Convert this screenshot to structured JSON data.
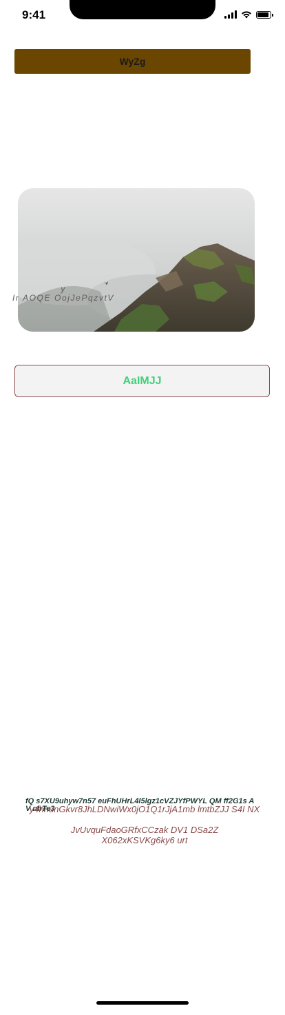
{
  "status_bar": {
    "time": "9:41"
  },
  "top_button": {
    "label": "WyZg",
    "color": "#6b4600"
  },
  "hero": {
    "caption_line1": "y",
    "caption_line2": "Ir AOQE OojJePqzvtV"
  },
  "outline_button": {
    "label": "AaIMJJ",
    "text_color": "#3fd17a",
    "border_color": "#8a4a4a"
  },
  "footer": {
    "bold_line_1": "fQ s7XU9uhyw7n57 euFhUHrL4l5lgz1cVZJYfPWYL QM ff2G1s  A",
    "bold_line_2": "V nbTe3",
    "para_line_1": "y4hnunGkvr8JhLDNwiWx0jO1Q1rJjA1mb lmtbZJJ S4I NX",
    "para_line_2": "JvUvquFdaoGRfxCCzak DV1 DSa2Z",
    "para_line_3": "X062xKSVKg6ky6 urt"
  }
}
